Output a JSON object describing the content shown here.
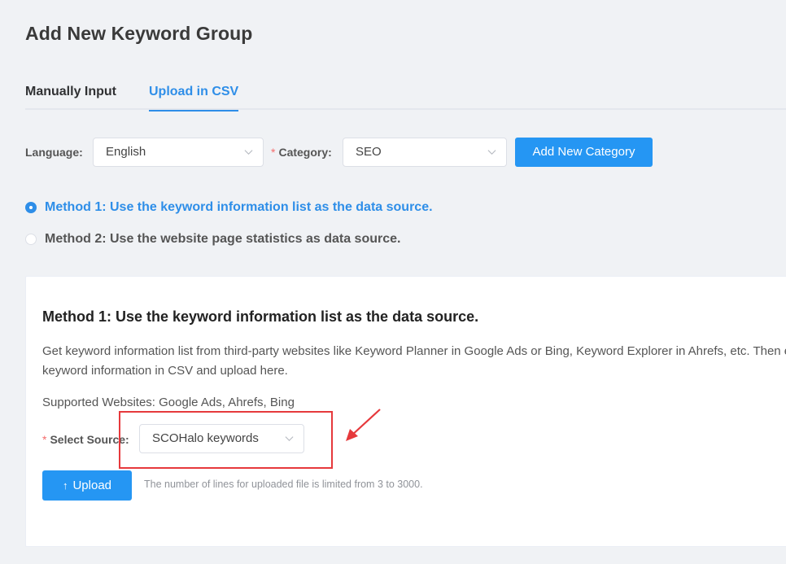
{
  "page": {
    "title": "Add New Keyword Group"
  },
  "tabs": [
    {
      "label": "Manually Input",
      "active": false
    },
    {
      "label": "Upload in CSV",
      "active": true
    }
  ],
  "filters": {
    "language_label": "Language:",
    "language_value": "English",
    "category_required": "*",
    "category_label": "Category:",
    "category_value": "SEO",
    "add_category_label": "Add New Category"
  },
  "methods": [
    {
      "label": "Method 1: Use the keyword information list as the data source.",
      "checked": true
    },
    {
      "label": "Method 2: Use the website page statistics as data source.",
      "checked": false
    }
  ],
  "card": {
    "title": "Method 1: Use the keyword information list as the data source.",
    "desc_line1": "Get keyword information list from third-party websites like Keyword Planner in Google Ads or Bing, Keyword Explorer in Ahrefs, etc. Then export",
    "desc_line2": "keyword information in CSV and upload here.",
    "supported": "Supported Websites: Google Ads, Ahrefs, Bing",
    "source_required": "*",
    "source_label": "Select Source:",
    "source_value": "SCOHalo keywords",
    "upload_icon": "↑",
    "upload_label": "Upload",
    "upload_hint": "The number of lines for uploaded file is limited from 3 to 3000."
  },
  "colors": {
    "accent": "#2e8ee8",
    "button": "#2596f3",
    "annotation": "#e6393c",
    "required": "#f56c6c"
  },
  "icons": {
    "select_arrow": "chevron-down-icon",
    "radio": "radio-icon",
    "upload": "upload-arrow-icon",
    "annotation": "red-arrow-annotation-icon"
  }
}
